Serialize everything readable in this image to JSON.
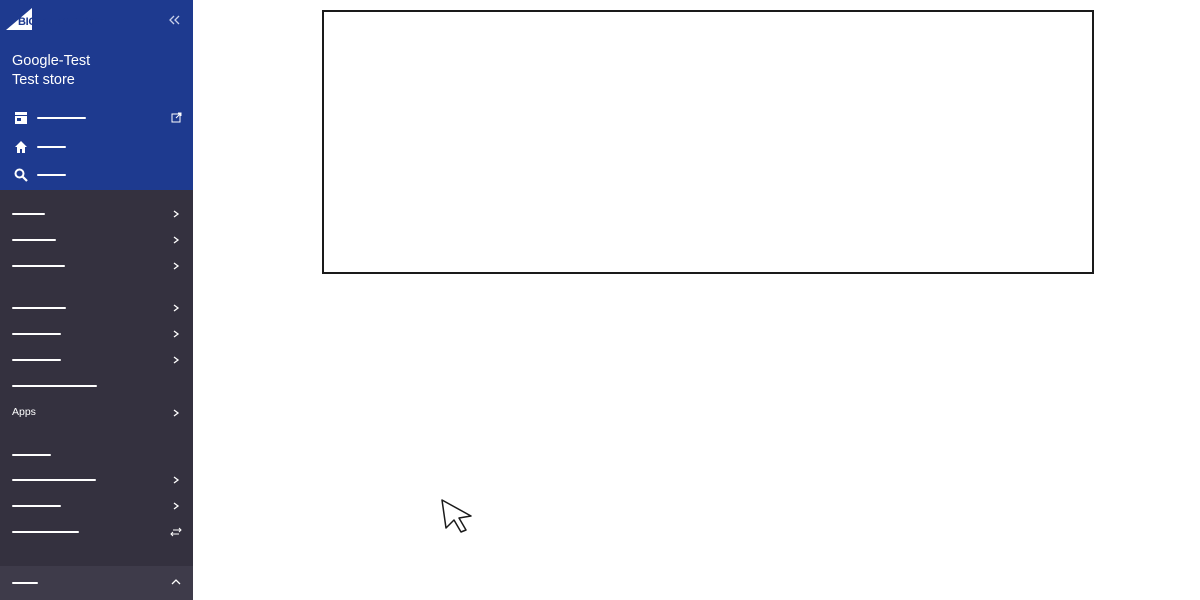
{
  "brand": {
    "logo_text": "BIGCOMMERCE",
    "accent": "#1e3a8f",
    "sidebar_bg": "#34313f"
  },
  "store": {
    "line1": "Google-Test",
    "line2": "Test store"
  },
  "top_nav": [
    {
      "icon": "storefront-icon",
      "trailing_icon": "external-link-icon"
    },
    {
      "icon": "home-icon"
    },
    {
      "icon": "search-icon"
    }
  ],
  "nav_items": [
    {
      "icon": "chevron-right-icon"
    },
    {
      "icon": "chevron-right-icon"
    },
    {
      "icon": "chevron-right-icon"
    },
    {
      "icon": "chevron-right-icon"
    },
    {
      "icon": "chevron-right-icon"
    },
    {
      "icon": "chevron-right-icon"
    },
    {},
    {
      "label": "Apps",
      "icon": "chevron-right-icon"
    },
    {},
    {
      "icon": "chevron-right-icon"
    },
    {
      "icon": "chevron-right-icon"
    },
    {
      "icon": "switch-arrows-icon"
    }
  ],
  "bottom_item": {
    "icon": "chevron-up-icon"
  }
}
